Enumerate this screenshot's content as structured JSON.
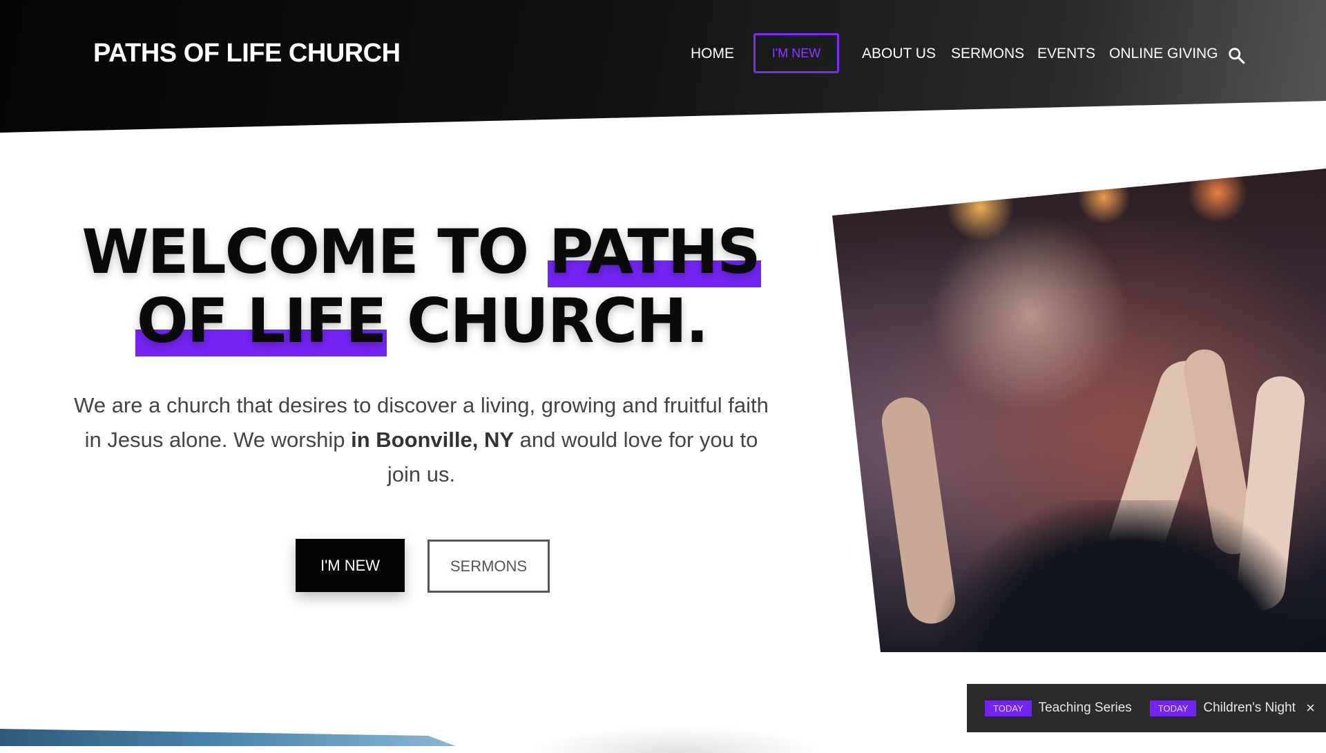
{
  "header": {
    "brand": "PATHS OF LIFE CHURCH",
    "nav": [
      {
        "label": "HOME"
      },
      {
        "label": "I'M NEW"
      },
      {
        "label": "ABOUT US"
      },
      {
        "label": "SERMONS"
      },
      {
        "label": "EVENTS"
      },
      {
        "label": "ONLINE GIVING"
      }
    ],
    "search_icon": "search-icon"
  },
  "hero": {
    "title_part1": "WELCOME TO ",
    "title_hl1": "PATHS",
    "title_hl2": "OF LIFE",
    "title_part2": " CHURCH.",
    "text_part1": "We are a church that desires to discover a living, growing and fruitful faith in Jesus alone. We worship ",
    "text_bold": "in Boonville, NY",
    "text_part2": " and would love for you to join us.",
    "primary_button": "I'M NEW",
    "secondary_button": "SERMONS"
  },
  "ticker": {
    "events": [
      {
        "badge": "TODAY",
        "title": "Teaching Series"
      },
      {
        "badge": "TODAY",
        "title": "Children's Night"
      }
    ],
    "close": "×"
  },
  "colors": {
    "accent": "#7424f5",
    "header_dark": "#050505",
    "ticker_bg": "#2b2b2b"
  }
}
